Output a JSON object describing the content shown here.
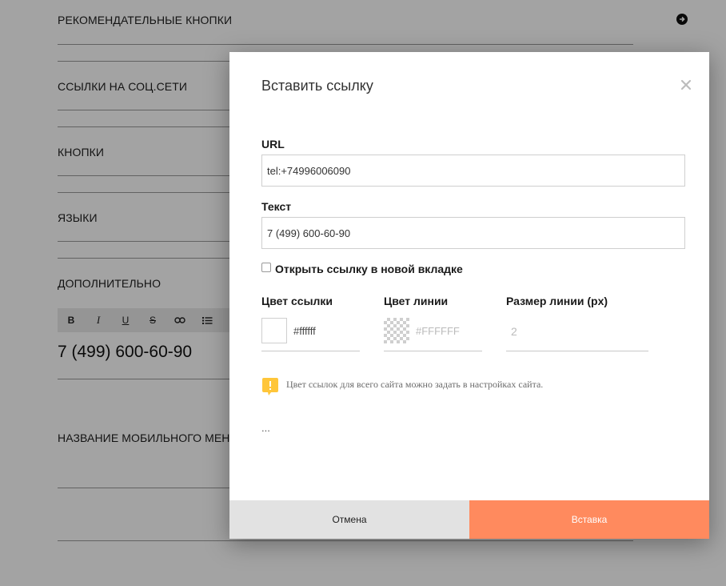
{
  "background": {
    "sections": [
      {
        "label": "РЕКОМЕНДАТЕЛЬНЫЕ КНОПКИ"
      },
      {
        "label": "ССЫЛКИ НА СОЦ.СЕТИ"
      },
      {
        "label": "КНОПКИ"
      },
      {
        "label": "ЯЗЫКИ"
      },
      {
        "label": "ДОПОЛНИТЕЛЬНО"
      },
      {
        "label": "НАЗВАНИЕ МОБИЛЬНОГО МЕНЮ"
      }
    ],
    "toolbar": {
      "bold": "B",
      "italic": "I",
      "underline": "U",
      "strike": "S"
    },
    "editor_text": "7 (499) 600-60-90"
  },
  "modal": {
    "title": "Вставить ссылку",
    "url": {
      "label": "URL",
      "value": "tel:+74996006090"
    },
    "text": {
      "label": "Текст",
      "value": "7 (499) 600-60-90"
    },
    "new_tab": {
      "label": "Открыть ссылку в новой вкладке",
      "checked": false
    },
    "link_color": {
      "label": "Цвет ссылки",
      "value": "#ffffff"
    },
    "line_color": {
      "label": "Цвет линии",
      "placeholder": "#FFFFFF"
    },
    "line_size": {
      "label": "Размер линии (px)",
      "placeholder": "2"
    },
    "note": "Цвет ссылок для всего сайта можно задать в настройках сайта.",
    "ellipsis": "...",
    "cancel_label": "Отмена",
    "insert_label": "Вставка"
  },
  "colors": {
    "accent": "#ff8a5e",
    "note_icon": "#ffc63a"
  }
}
